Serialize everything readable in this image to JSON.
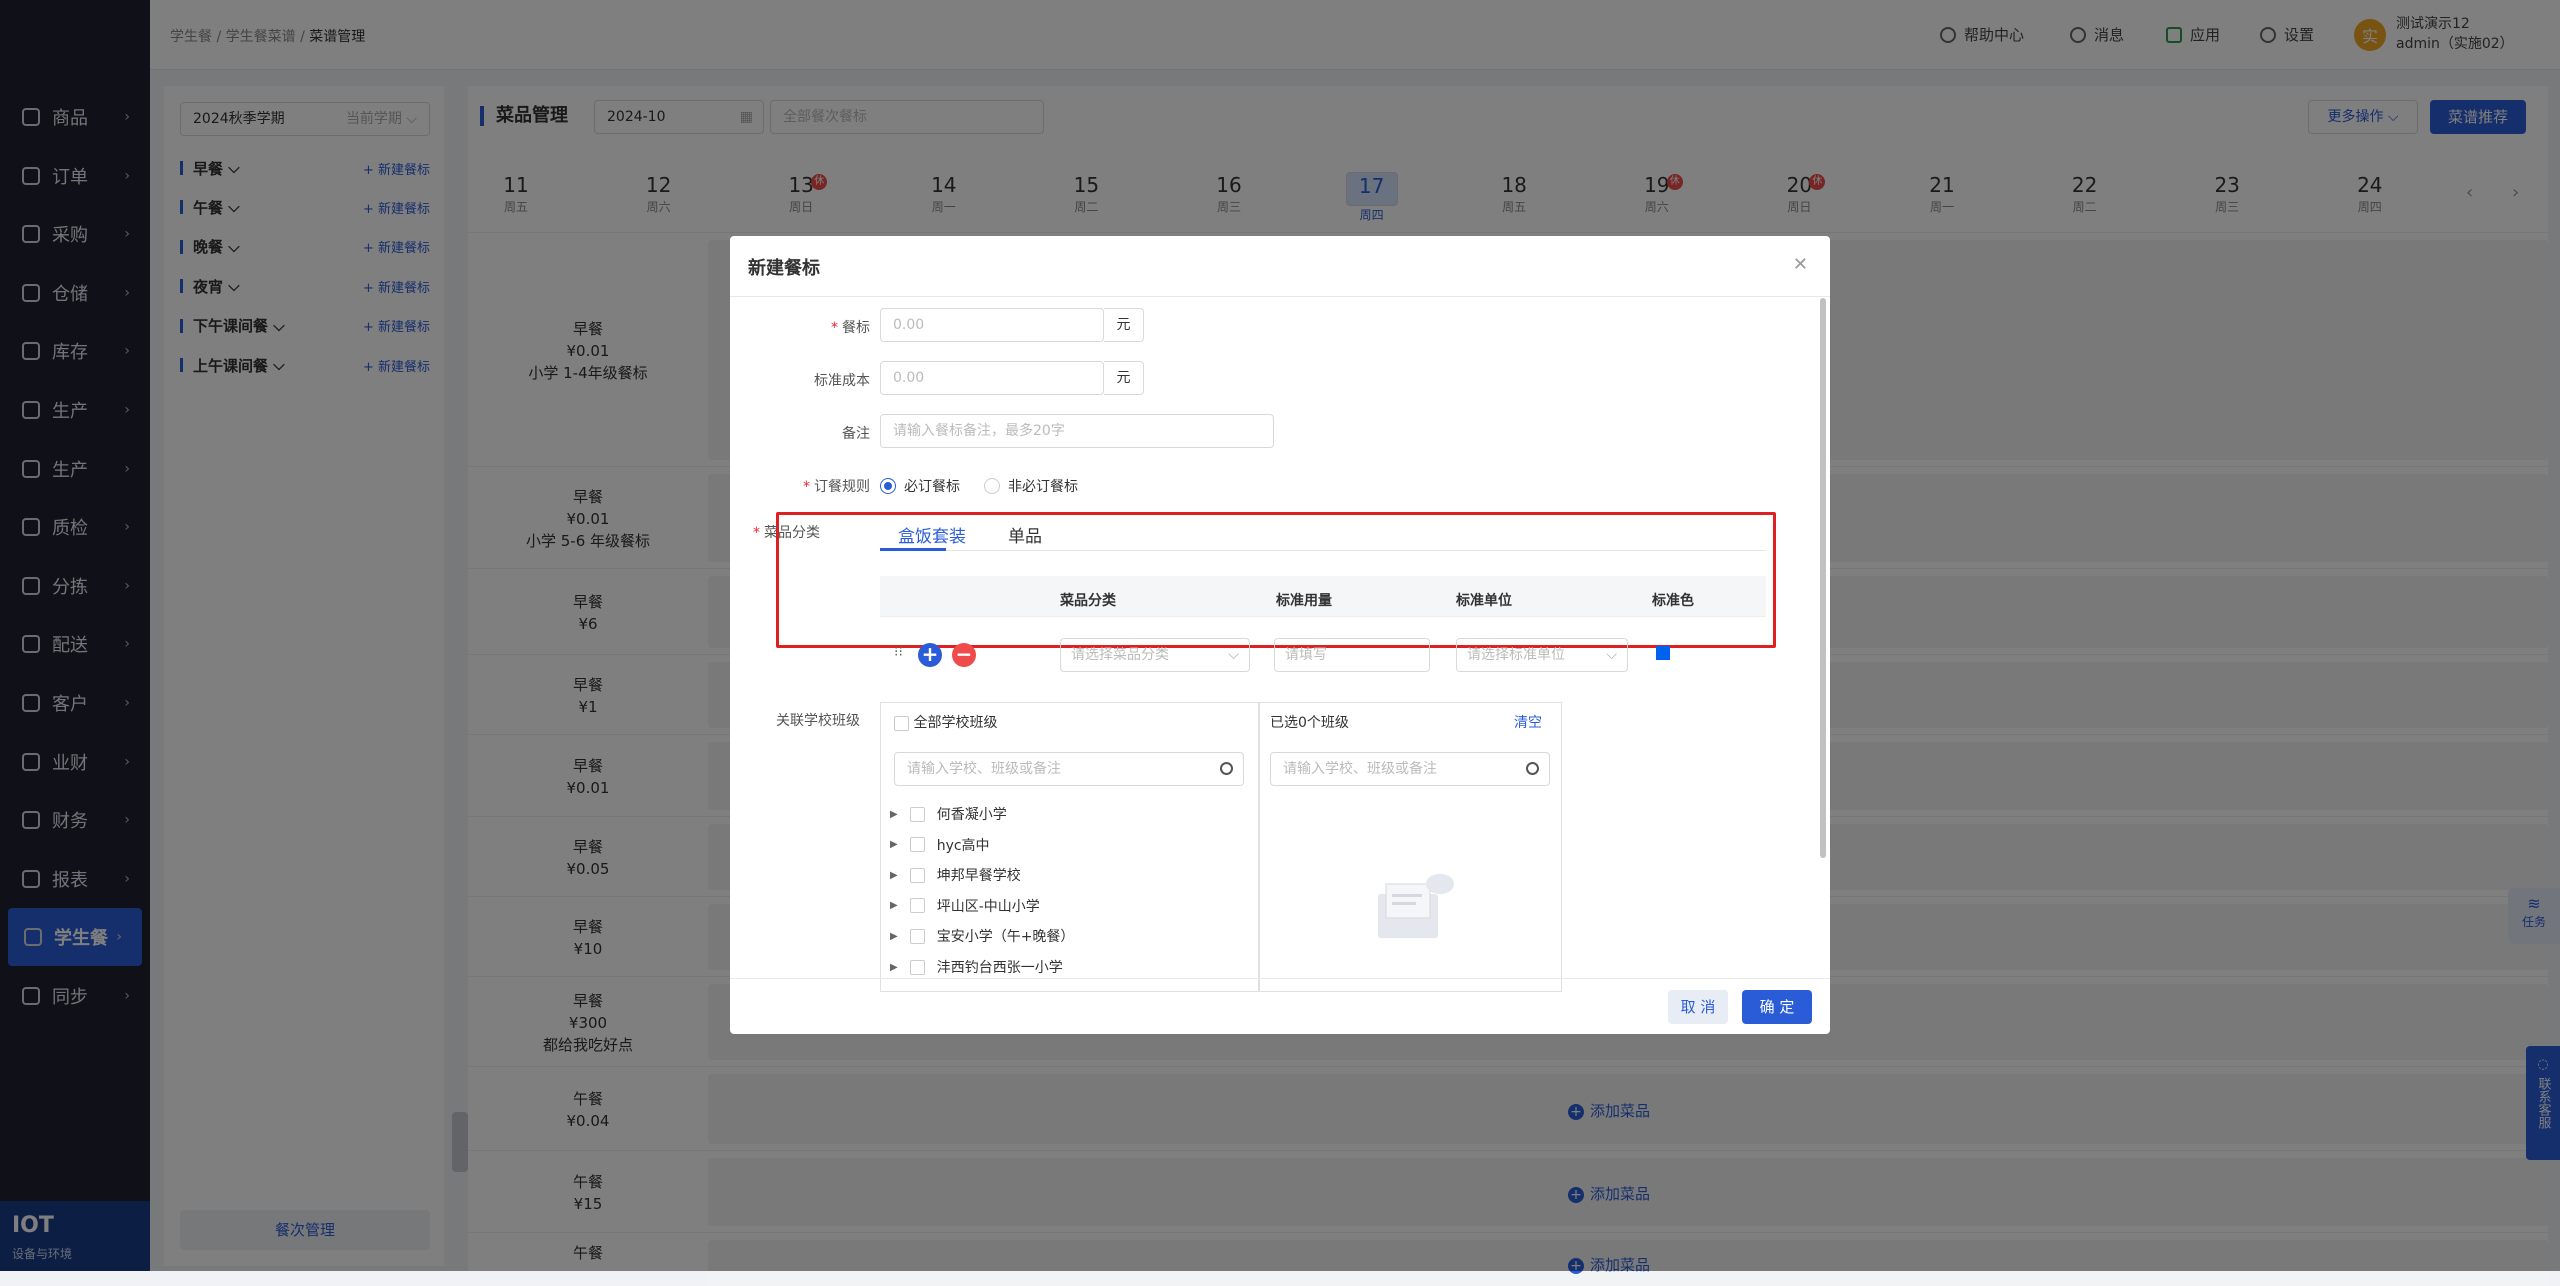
{
  "topbar": {
    "breadcrumb": [
      "学生餐",
      "学生餐菜谱",
      "菜谱管理"
    ],
    "help": "帮助中心",
    "messages": "消息",
    "apps": "应用",
    "settings": "设置",
    "avatar_text": "实",
    "user_name": "测试演示12",
    "user_account": "admin（实施02）"
  },
  "sidebar": {
    "items": [
      "商品",
      "订单",
      "采购",
      "仓储",
      "库存",
      "生产",
      "生产",
      "质检",
      "分拣",
      "配送",
      "客户",
      "业财",
      "财务",
      "报表",
      "学生餐",
      "同步"
    ],
    "active": "学生餐",
    "brand_title": "IOT",
    "brand_sub": "设备与环境"
  },
  "left_panel": {
    "term": "2024秋季学期",
    "term_tag": "当前学期",
    "meals": [
      "早餐",
      "午餐",
      "晚餐",
      "夜宵",
      "下午课间餐",
      "上午课间餐"
    ],
    "add_label": "+ 新建餐标",
    "manage_button": "餐次管理"
  },
  "main": {
    "title": "菜品管理",
    "month": "2024-10",
    "meal_filter_placeholder": "全部餐次餐标",
    "more_ops": "更多操作",
    "recommend": "菜谱推荐",
    "rest_badge": "休",
    "days": [
      {
        "n": "11",
        "w": "周五"
      },
      {
        "n": "12",
        "w": "周六"
      },
      {
        "n": "13",
        "w": "周日",
        "rest": true
      },
      {
        "n": "14",
        "w": "周一"
      },
      {
        "n": "15",
        "w": "周二"
      },
      {
        "n": "16",
        "w": "周三"
      },
      {
        "n": "17",
        "w": "周四",
        "selected": true
      },
      {
        "n": "18",
        "w": "周五"
      },
      {
        "n": "19",
        "w": "周六",
        "rest": true
      },
      {
        "n": "20",
        "w": "周日",
        "rest": true
      },
      {
        "n": "21",
        "w": "周一"
      },
      {
        "n": "22",
        "w": "周二"
      },
      {
        "n": "23",
        "w": "周三"
      },
      {
        "n": "24",
        "w": "周四"
      }
    ],
    "slots": [
      {
        "meal": "早餐",
        "price": "¥0.01",
        "note": "小学 1-4年级餐标"
      },
      {
        "meal": "早餐",
        "price": "¥0.01",
        "note": "小学 5-6 年级餐标"
      },
      {
        "meal": "早餐",
        "price": "¥6",
        "note": ""
      },
      {
        "meal": "早餐",
        "price": "¥1",
        "note": ""
      },
      {
        "meal": "早餐",
        "price": "¥0.01",
        "note": ""
      },
      {
        "meal": "早餐",
        "price": "¥0.05",
        "note": ""
      },
      {
        "meal": "早餐",
        "price": "¥10",
        "note": ""
      },
      {
        "meal": "早餐",
        "price": "¥300",
        "note": "都给我吃好点"
      },
      {
        "meal": "午餐",
        "price": "¥0.04",
        "note": ""
      },
      {
        "meal": "午餐",
        "price": "¥15",
        "note": ""
      },
      {
        "meal": "午餐",
        "price": "",
        "note": ""
      }
    ],
    "add_dish": "添加菜品",
    "task_label": "任务",
    "service_label": "联系客服"
  },
  "modal": {
    "title": "新建餐标",
    "fields": {
      "meal_standard_label": "餐标",
      "meal_standard_placeholder": "0.00",
      "unit": "元",
      "std_cost_label": "标准成本",
      "std_cost_placeholder": "0.00",
      "remark_label": "备注",
      "remark_placeholder": "请输入餐标备注，最多20字",
      "order_rule_label": "订餐规则",
      "order_required": "必订餐标",
      "order_optional": "非必订餐标",
      "dish_category_label": "菜品分类"
    },
    "tabs": [
      "盒饭套装",
      "单品"
    ],
    "table": {
      "headers": [
        "菜品分类",
        "标准用量",
        "标准单位",
        "标准色"
      ],
      "category_placeholder": "请选择菜品分类",
      "amount_placeholder": "请填写",
      "unit_placeholder": "请选择标准单位",
      "color": "#0060f0"
    },
    "school": {
      "label": "关联学校班级",
      "all_label": "全部学校班级",
      "search_placeholder": "请输入学校、班级或备注",
      "selected_label": "已选0个班级",
      "clear": "清空",
      "list": [
        "何香凝小学",
        "hyc高中",
        "坤邦早餐学校",
        "坪山区-中山小学",
        "宝安小学（午+晚餐）",
        "沣西钓台西张一小学"
      ]
    },
    "cancel": "取 消",
    "confirm": "确 定"
  }
}
